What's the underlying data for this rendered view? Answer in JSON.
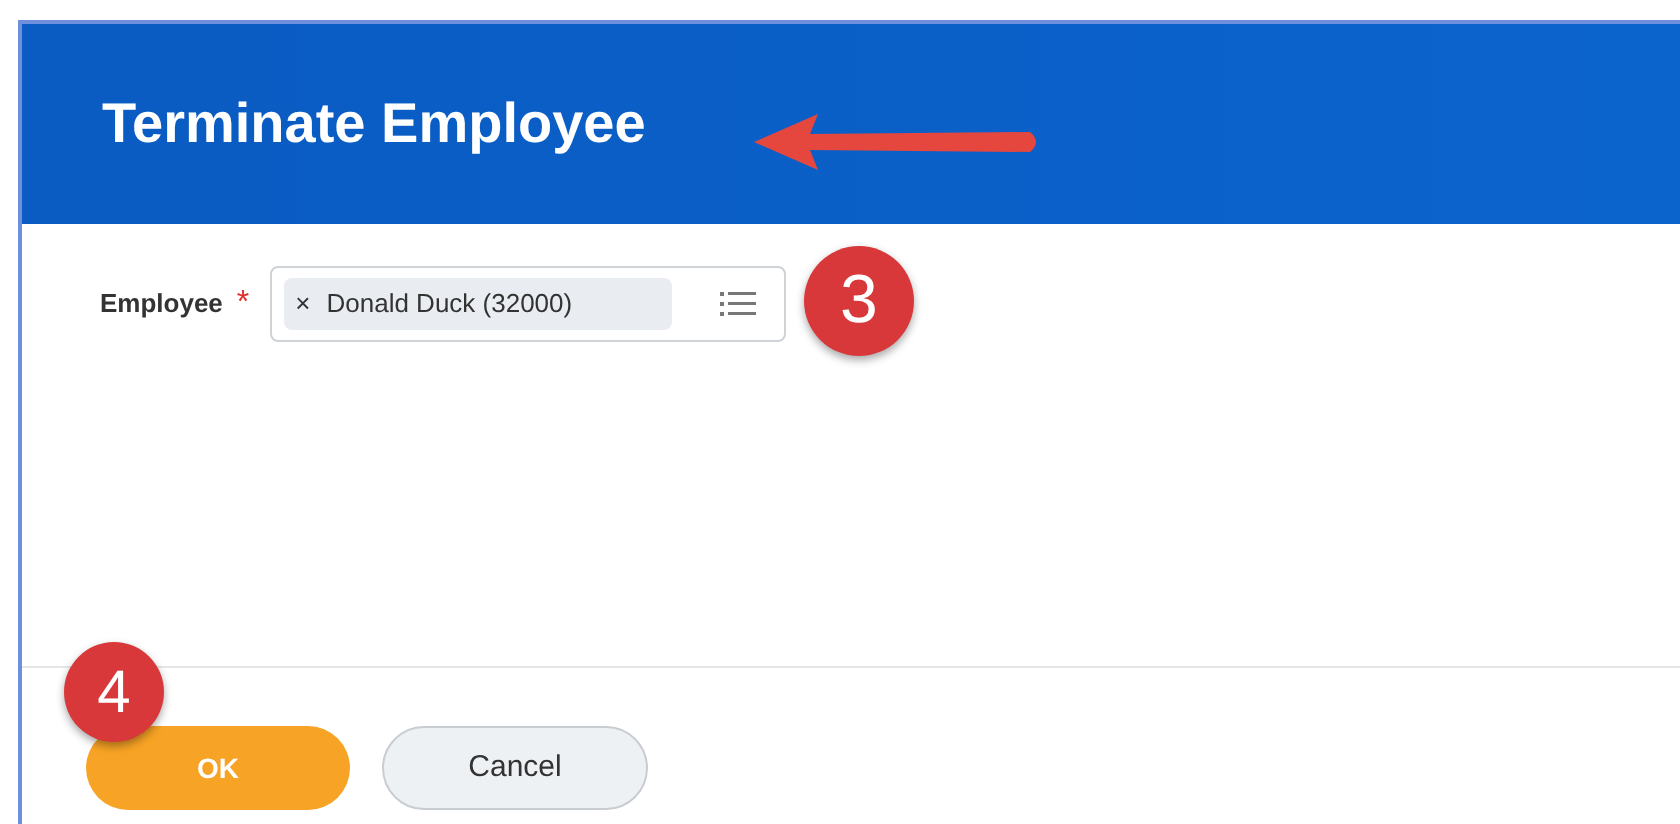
{
  "header": {
    "title": "Terminate Employee"
  },
  "fields": [
    {
      "label": "Employee",
      "required": true,
      "required_mark": "*",
      "value": "Donald Duck (32000)",
      "remove": "×",
      "annotation": "3"
    }
  ],
  "buttons": [
    {
      "label": "OK",
      "kind": "primary",
      "annotation": "4"
    },
    {
      "label": "Cancel",
      "kind": "secondary"
    }
  ]
}
